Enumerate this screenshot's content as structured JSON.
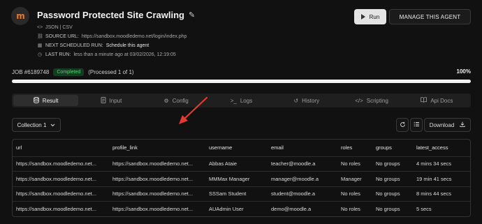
{
  "agent": {
    "title": "Password Protected Site Crawling",
    "formats": "JSON | CSV",
    "source_url_label": "SOURCE URL:",
    "source_url": "https://sandbox.moodledemo.net/login/index.php",
    "next_run_label": "NEXT SCHEDULED RUN:",
    "next_run_value": "Schedule this agent",
    "last_run_label": "LAST RUN:",
    "last_run_value": "less than a minute ago at 03/02/2026, 12:19:05",
    "logo_text": "m"
  },
  "actions": {
    "run_label": "Run",
    "manage_label": "MANAGE THIS AGENT"
  },
  "job": {
    "id_label": "JOB #6189748",
    "status": "Completed",
    "processed": "(Processed 1 of 1)",
    "percent_label": "100%",
    "progress": 1.0
  },
  "tabs": [
    {
      "label": "Result",
      "icon": "database-icon"
    },
    {
      "label": "Input",
      "icon": "document-icon"
    },
    {
      "label": "Config",
      "icon": "gear-icon"
    },
    {
      "label": "Logs",
      "icon": "terminal-icon"
    },
    {
      "label": "History",
      "icon": "history-icon"
    },
    {
      "label": "Scripting",
      "icon": "code-icon"
    },
    {
      "label": "Api Docs",
      "icon": "book-icon"
    }
  ],
  "collection": {
    "selected": "Collection 1"
  },
  "toolbar": {
    "download_label": "Download"
  },
  "table": {
    "columns": [
      "url",
      "profile_link",
      "username",
      "email",
      "roles",
      "groups",
      "latest_access"
    ],
    "rows": [
      [
        "https://sandbox.moodledemo.net...",
        "https://sandbox.moodledemo.net...",
        "Abbas Ataie",
        "teacher@moodle.a",
        "No roles",
        "No groups",
        "4 mins 34 secs"
      ],
      [
        "https://sandbox.moodledemo.net...",
        "https://sandbox.moodledemo.net...",
        "MMMax Manager",
        "manager@moodle.a",
        "Manager",
        "No groups",
        "19 min 41 secs"
      ],
      [
        "https://sandbox.moodledemo.net...",
        "https://sandbox.moodledemo.net...",
        "SSSam Student",
        "student@moodle.a",
        "No roles",
        "No groups",
        "8 mins 44 secs"
      ],
      [
        "https://sandbox.moodledemo.net...",
        "https://sandbox.moodledemo.net...",
        "AUAdmin User",
        "demo@moodle.a",
        "No roles",
        "No groups",
        "5 secs"
      ]
    ]
  },
  "colors": {
    "accent_orange": "#e8792c",
    "status_green": "#4fd178",
    "annotation_red": "#e23a2f"
  }
}
